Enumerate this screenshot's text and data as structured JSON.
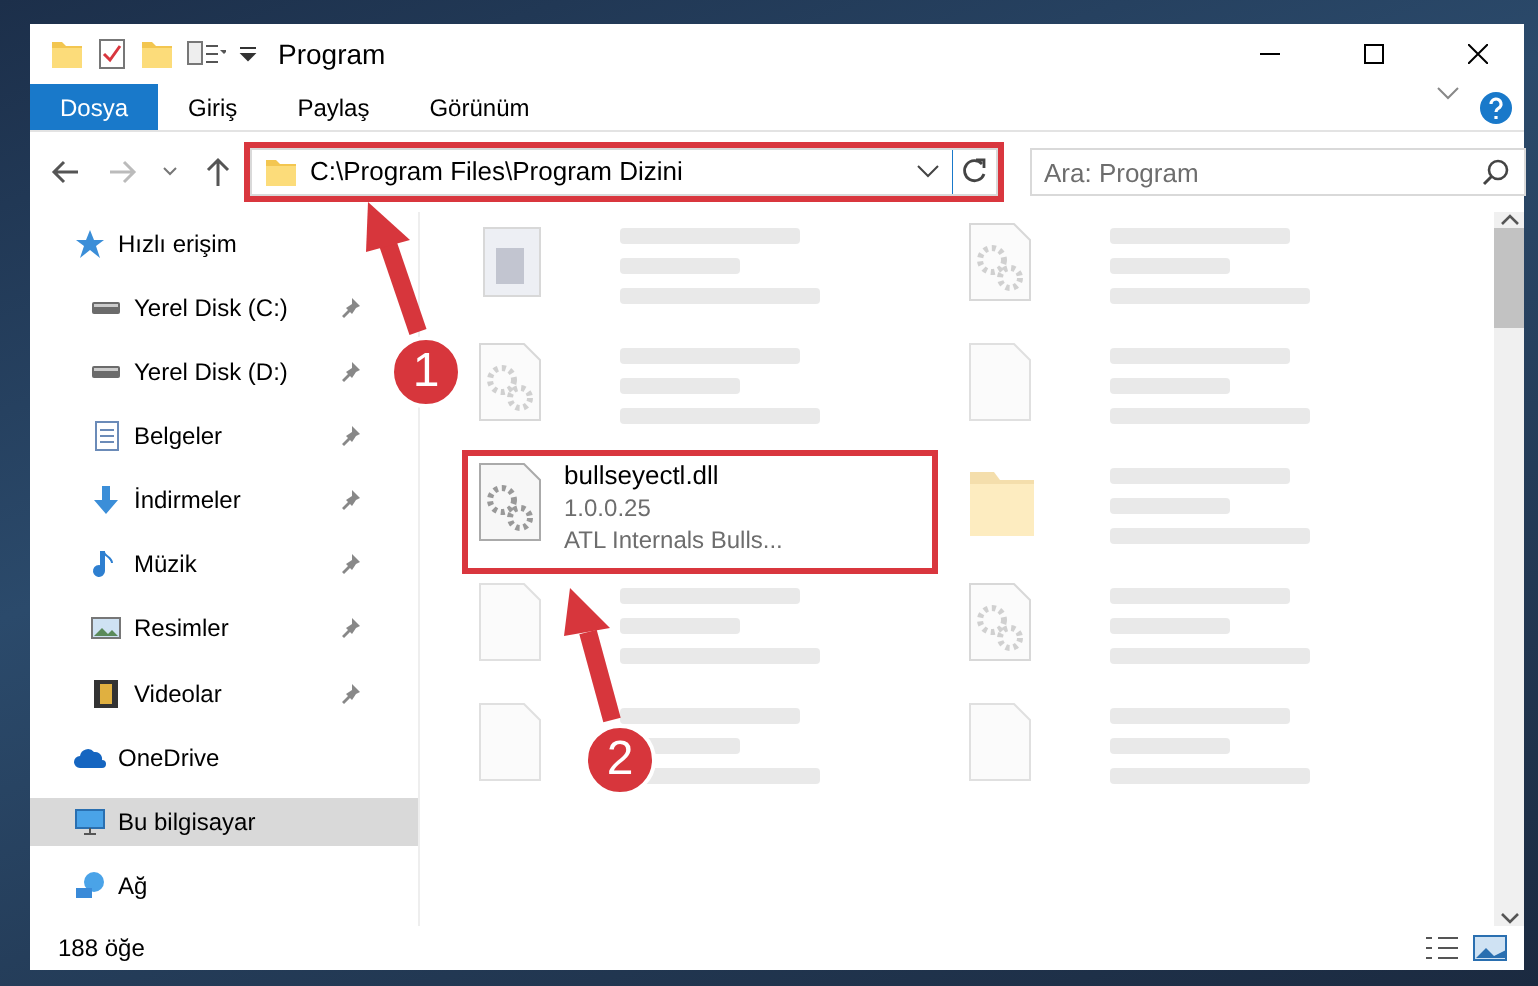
{
  "window": {
    "title": "Program"
  },
  "ribbon_tabs": [
    {
      "label": "Dosya",
      "selected": true
    },
    {
      "label": "Giriş",
      "selected": false
    },
    {
      "label": "Paylaş",
      "selected": false
    },
    {
      "label": "Görünüm",
      "selected": false
    }
  ],
  "address_bar": {
    "path": "C:\\Program Files\\Program Dizini",
    "highlighted": true
  },
  "search": {
    "placeholder": "Ara: Program"
  },
  "nav_items": [
    {
      "label": "Hızlı erişim",
      "kind": "star",
      "selected": false,
      "children": [
        {
          "label": "Yerel Disk (C:)",
          "kind": "drive",
          "pinned": true
        },
        {
          "label": "Yerel Disk (D:)",
          "kind": "drive",
          "pinned": true
        },
        {
          "label": "Belgeler",
          "kind": "document",
          "pinned": true
        },
        {
          "label": "İndirmeler",
          "kind": "download",
          "pinned": true
        },
        {
          "label": "Müzik",
          "kind": "music",
          "pinned": true
        },
        {
          "label": "Resimler",
          "kind": "picture",
          "pinned": true
        },
        {
          "label": "Videolar",
          "kind": "video",
          "pinned": true
        }
      ]
    },
    {
      "label": "OneDrive",
      "kind": "cloud",
      "selected": false
    },
    {
      "label": "Bu bilgisayar",
      "kind": "computer",
      "selected": true
    },
    {
      "label": "Ağ",
      "kind": "network",
      "selected": false
    }
  ],
  "files": [
    {
      "kind": "exe",
      "highlighted": false,
      "blurred": true
    },
    {
      "kind": "dll",
      "highlighted": false,
      "blurred": true
    },
    {
      "kind": "dll",
      "highlighted": false,
      "blurred": true
    },
    {
      "kind": "file",
      "highlighted": false,
      "blurred": true
    },
    {
      "name": "bullseyectl.dll",
      "details": [
        "1.0.0.25",
        "ATL Internals Bulls..."
      ],
      "kind": "dll",
      "highlighted": true,
      "blurred": false
    },
    {
      "kind": "folder",
      "highlighted": false,
      "blurred": true
    },
    {
      "kind": "file",
      "highlighted": false,
      "blurred": true
    },
    {
      "kind": "dll",
      "highlighted": false,
      "blurred": true
    },
    {
      "kind": "file",
      "highlighted": false,
      "blurred": true
    },
    {
      "kind": "file",
      "highlighted": false,
      "blurred": true
    }
  ],
  "callouts": [
    {
      "number": "1"
    },
    {
      "number": "2"
    }
  ],
  "status_bar": {
    "item_count": "188 öğe"
  }
}
